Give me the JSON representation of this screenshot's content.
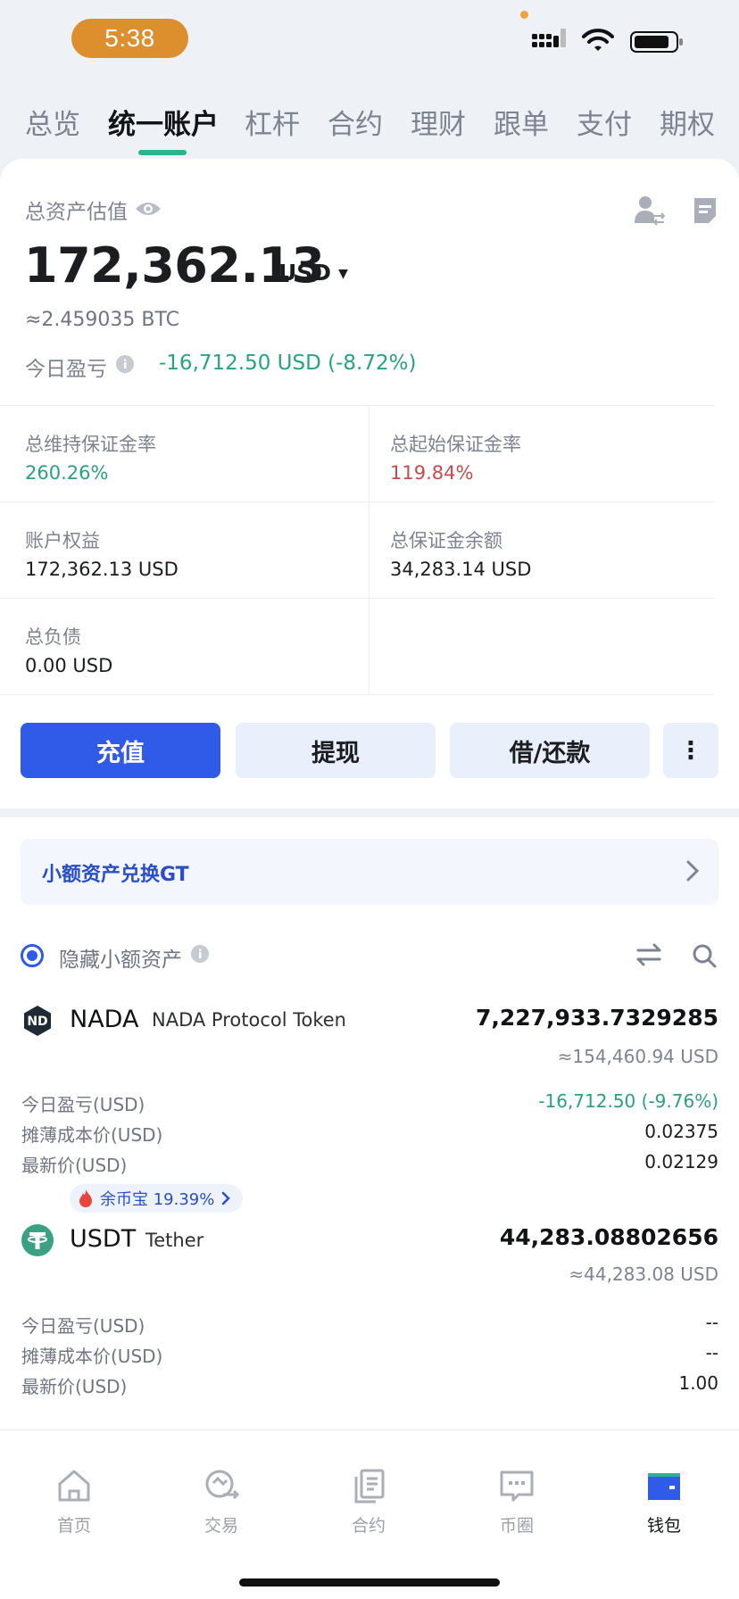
{
  "status_bar": {
    "time": "5:38"
  },
  "top_tabs": [
    "总览",
    "统一账户",
    "杠杆",
    "合约",
    "理财",
    "跟单",
    "支付",
    "期权"
  ],
  "active_tab": "统一账户",
  "overview": {
    "total_label": "总资产估值",
    "total_value": "172,362.13",
    "currency": "USD",
    "btc_value": "≈2.459035 BTC",
    "today_pnl_label": "今日盈亏",
    "today_pnl_value": "-16,712.50 USD (-8.72%)"
  },
  "stats": {
    "maint_margin_label": "总维持保证金率",
    "maint_margin_value": "260.26%",
    "initial_margin_label": "总起始保证金率",
    "initial_margin_value": "119.84%",
    "equity_label": "账户权益",
    "equity_value": "172,362.13 USD",
    "margin_balance_label": "总保证金余额",
    "margin_balance_value": "34,283.14 USD",
    "liabilities_label": "总负债",
    "liabilities_value": "0.00 USD"
  },
  "actions": {
    "deposit": "充值",
    "withdraw": "提现",
    "borrow": "借/还款",
    "more": "⋮"
  },
  "convert_banner": "小额资产兑换GT",
  "hide_small_label": "隐藏小额资产",
  "assets": [
    {
      "symbol": "NADA",
      "name": "NADA Protocol Token",
      "amount": "7,227,933.7329285",
      "usd": "≈154,460.94 USD",
      "pnl_label": "今日盈亏(USD)",
      "pnl_value": "-16,712.50 (-9.76%)",
      "cost_label": "摊薄成本价(USD)",
      "cost_value": "0.02375",
      "price_label": "最新价(USD)",
      "price_value": "0.02129"
    },
    {
      "symbol": "USDT",
      "name": "Tether",
      "badge": "余币宝 19.39%",
      "amount": "44,283.08802656",
      "usd": "≈44,283.08 USD",
      "pnl_label": "今日盈亏(USD)",
      "pnl_value": "--",
      "cost_label": "摊薄成本价(USD)",
      "cost_value": "--",
      "price_label": "最新价(USD)",
      "price_value": "1.00"
    }
  ],
  "bottom_nav": [
    {
      "label": "首页",
      "icon": "home-icon"
    },
    {
      "label": "交易",
      "icon": "trade-icon"
    },
    {
      "label": "合约",
      "icon": "contract-icon"
    },
    {
      "label": "币圈",
      "icon": "chat-icon"
    },
    {
      "label": "钱包",
      "icon": "wallet-icon",
      "active": true
    }
  ],
  "colors": {
    "accent": "#2f5be8",
    "positive": "#27a37f",
    "negative": "#c94a4a",
    "time_pill": "#dd8f2e"
  }
}
